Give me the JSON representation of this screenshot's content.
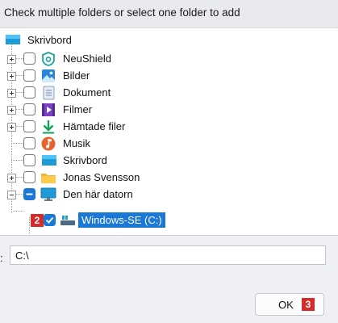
{
  "dialog": {
    "instruction": "Check multiple folders or select one folder to add"
  },
  "tree": {
    "root": {
      "label": "Skrivbord",
      "icon": "desktop-icon"
    },
    "items": [
      {
        "label": "NeuShield",
        "icon": "neushield-icon",
        "expandable": true,
        "checked": false
      },
      {
        "label": "Bilder",
        "icon": "pictures-icon",
        "expandable": true,
        "checked": false
      },
      {
        "label": "Dokument",
        "icon": "documents-icon",
        "expandable": true,
        "checked": false
      },
      {
        "label": "Filmer",
        "icon": "videos-icon",
        "expandable": true,
        "checked": false
      },
      {
        "label": "Hämtade filer",
        "icon": "downloads-icon",
        "expandable": true,
        "checked": false
      },
      {
        "label": "Musik",
        "icon": "music-icon",
        "expandable": false,
        "checked": false
      },
      {
        "label": "Skrivbord",
        "icon": "desktop-icon",
        "expandable": false,
        "checked": false
      },
      {
        "label": "Jonas Svensson",
        "icon": "folder-icon",
        "expandable": true,
        "checked": false
      },
      {
        "label": "Den här datorn",
        "icon": "computer-icon",
        "expandable": true,
        "expanded": true,
        "checked": "partial"
      },
      {
        "label": "Windows-SE (C:)",
        "icon": "drive-icon",
        "expandable": false,
        "checked": true,
        "selected": true
      }
    ]
  },
  "badges": {
    "drive_badge": "2",
    "ok_badge": "3"
  },
  "path": {
    "label": ":",
    "value": "C:\\"
  },
  "buttons": {
    "ok_label": "OK"
  },
  "colors": {
    "selection": "#1b78d7",
    "checkbox_checked": "#1b78d7",
    "badge": "#d62b2b"
  }
}
